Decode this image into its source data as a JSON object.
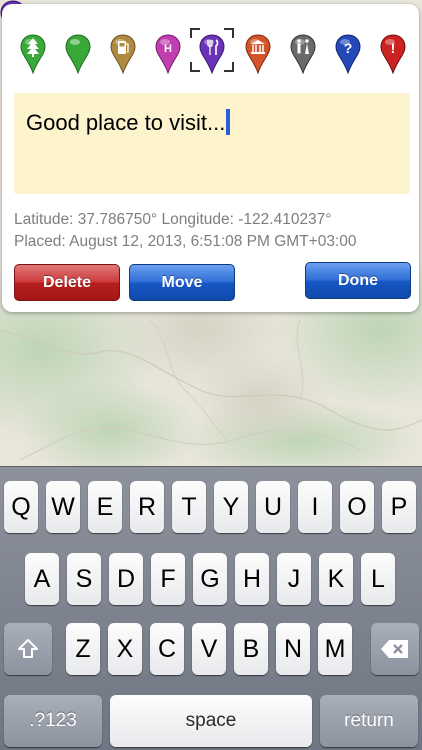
{
  "pin_palette": [
    {
      "name": "tree-pin-icon",
      "color": "#3aa83a",
      "glyph": "tree"
    },
    {
      "name": "plain-green-pin-icon",
      "color": "#39a839",
      "glyph": "none"
    },
    {
      "name": "gas-pin-icon",
      "color": "#b08a3e",
      "glyph": "gas"
    },
    {
      "name": "hotel-pin-icon",
      "color": "#c03fb0",
      "glyph": "H"
    },
    {
      "name": "restaurant-pin-icon",
      "color": "#6b33b8",
      "glyph": "fork",
      "selected": true
    },
    {
      "name": "museum-pin-icon",
      "color": "#d4542a",
      "glyph": "museum"
    },
    {
      "name": "restroom-pin-icon",
      "color": "#6a6a6a",
      "glyph": "people"
    },
    {
      "name": "question-pin-icon",
      "color": "#2549b8",
      "glyph": "?"
    },
    {
      "name": "alert-pin-icon",
      "color": "#cc2222",
      "glyph": "!"
    }
  ],
  "note": {
    "text": "Good place to visit..."
  },
  "meta": {
    "coords_text": "Latitude: 37.786750° Longitude: -122.410237°",
    "placed_text": "Placed: August 12, 2013, 6:51:08 PM GMT+03:00"
  },
  "buttons": {
    "delete": "Delete",
    "move": "Move",
    "done": "Done"
  },
  "map_pin": {
    "icon": "restaurant-pin-icon",
    "color": "#6b33b8"
  },
  "keyboard": {
    "row1": [
      "Q",
      "W",
      "E",
      "R",
      "T",
      "Y",
      "U",
      "I",
      "O",
      "P"
    ],
    "row2": [
      "A",
      "S",
      "D",
      "F",
      "G",
      "H",
      "J",
      "K",
      "L"
    ],
    "row3": [
      "Z",
      "X",
      "C",
      "V",
      "B",
      "N",
      "M"
    ],
    "numbers_label": ".?123",
    "space_label": "space",
    "return_label": "return",
    "shift_icon": "shift-arrow-icon",
    "delete_icon": "backspace-icon"
  }
}
